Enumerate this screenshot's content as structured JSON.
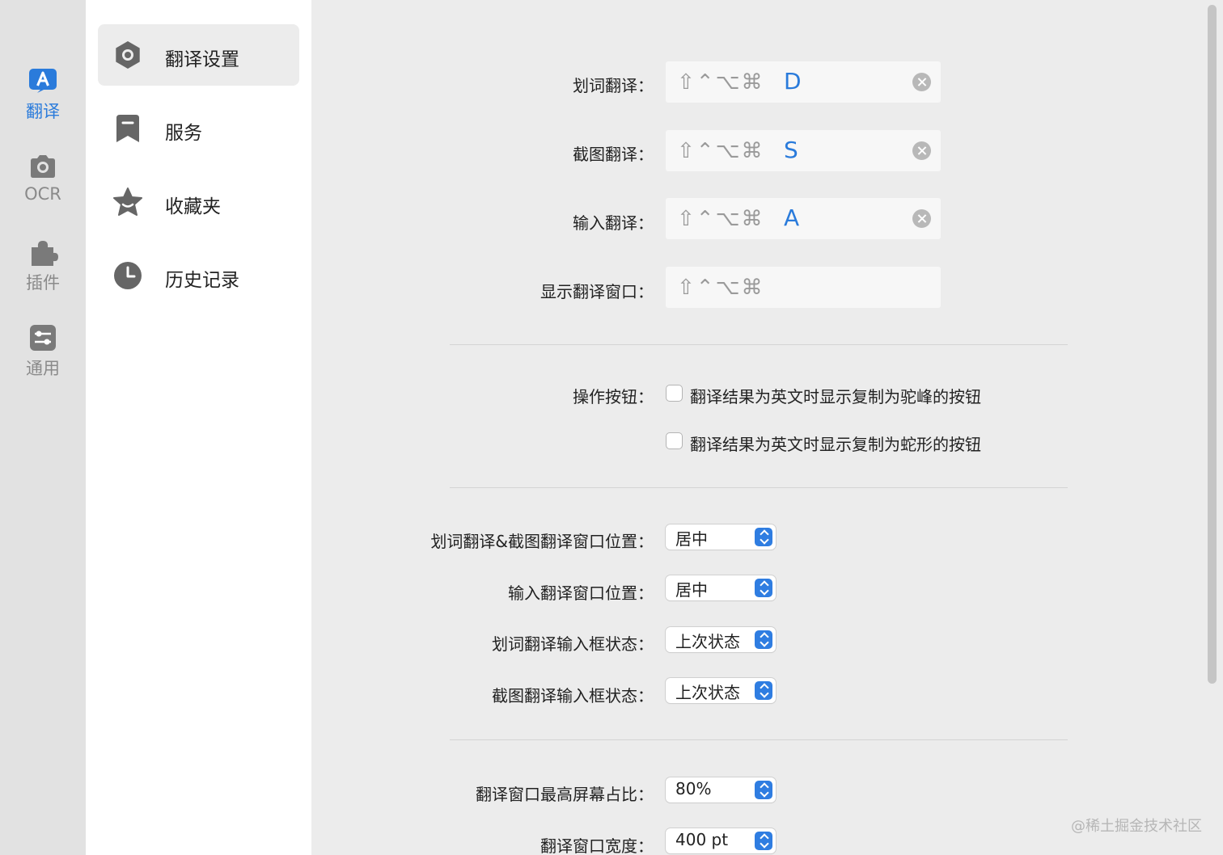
{
  "window": {
    "controls": [
      "close",
      "minimize",
      "zoom"
    ]
  },
  "rail": {
    "items": [
      {
        "label": "翻译",
        "icon": "translate-icon",
        "active": true
      },
      {
        "label": "OCR",
        "icon": "camera-icon",
        "active": false
      },
      {
        "label": "插件",
        "icon": "puzzle-icon",
        "active": false
      },
      {
        "label": "通用",
        "icon": "sliders-icon",
        "active": false
      }
    ]
  },
  "sidebar": {
    "items": [
      {
        "label": "翻译设置",
        "icon": "gear-icon",
        "active": true
      },
      {
        "label": "服务",
        "icon": "bookmark-icon",
        "active": false
      },
      {
        "label": "收藏夹",
        "icon": "star-icon",
        "active": false
      },
      {
        "label": "历史记录",
        "icon": "clock-icon",
        "active": false
      }
    ]
  },
  "shortcuts": [
    {
      "label": "划词翻译：",
      "modifiers": "⇧⌃⌥⌘",
      "key": "D",
      "clearable": true
    },
    {
      "label": "截图翻译：",
      "modifiers": "⇧⌃⌥⌘",
      "key": "S",
      "clearable": true
    },
    {
      "label": "输入翻译：",
      "modifiers": "⇧⌃⌥⌘",
      "key": "A",
      "clearable": true
    },
    {
      "label": "显示翻译窗口：",
      "modifiers": "⇧⌃⌥⌘",
      "key": "",
      "clearable": false
    }
  ],
  "action_buttons": {
    "label": "操作按钮：",
    "options": [
      {
        "label": "翻译结果为英文时显示复制为驼峰的按钮",
        "checked": false
      },
      {
        "label": "翻译结果为英文时显示复制为蛇形的按钮",
        "checked": false
      }
    ]
  },
  "popups": [
    {
      "label": "划词翻译&截图翻译窗口位置：",
      "value": "居中"
    },
    {
      "label": "输入翻译窗口位置：",
      "value": "居中"
    },
    {
      "label": "划词翻译输入框状态：",
      "value": "上次状态"
    },
    {
      "label": "截图翻译输入框状态：",
      "value": "上次状态"
    },
    {
      "label": "翻译窗口最高屏幕占比：",
      "value": "80%"
    },
    {
      "label": "翻译窗口宽度：",
      "value": "400 pt"
    }
  ],
  "watermark": "@稀土掘金技术社区",
  "colors": {
    "accent": "#2a7bdb",
    "popup_arrow": "#2f7de1",
    "icon_gray": "#666666"
  }
}
